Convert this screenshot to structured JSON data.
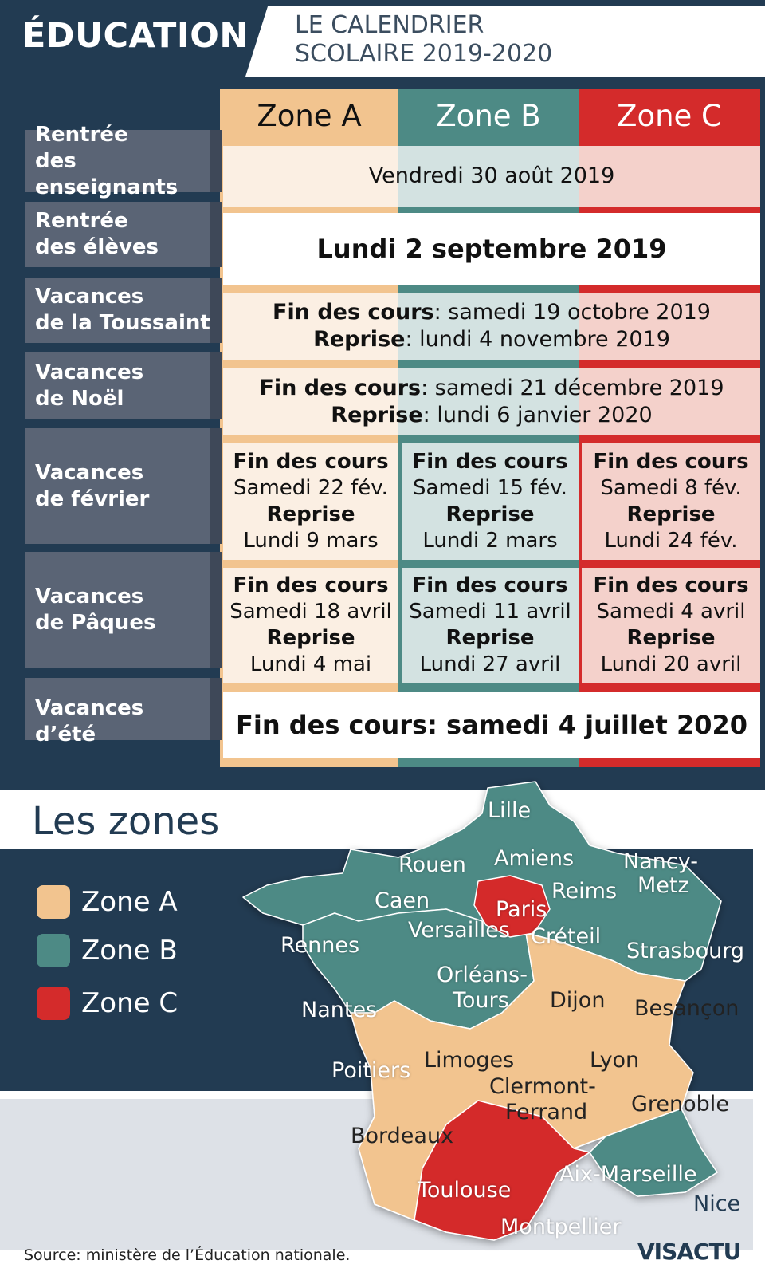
{
  "header": {
    "title": "ÉDUCATION",
    "subtitle_line1": "LE CALENDRIER",
    "subtitle_line2": "SCOLAIRE 2019-2020"
  },
  "zones": {
    "a": {
      "label": "Zone A",
      "color": "#f2c48f"
    },
    "b": {
      "label": "Zone B",
      "color": "#4d8a85"
    },
    "c": {
      "label": "Zone C",
      "color": "#d42b2b"
    }
  },
  "rows": {
    "enseignants": {
      "label1": "Rentrée",
      "label2": "des enseignants",
      "text": "Vendredi 30 août 2019"
    },
    "eleves": {
      "label1": "Rentrée",
      "label2": "des élèves",
      "text": "Lundi 2 septembre 2019"
    },
    "toussaint": {
      "label1": "Vacances",
      "label2": "de la Toussaint",
      "fin_label": "Fin des cours",
      "fin_value": ": samedi 19 octobre 2019",
      "reprise_label": "Reprise",
      "reprise_value": ": lundi 4 novembre 2019"
    },
    "noel": {
      "label1": "Vacances",
      "label2": "de Noël",
      "fin_label": "Fin des cours",
      "fin_value": ": samedi 21 décembre 2019",
      "reprise_label": "Reprise",
      "reprise_value": ": lundi 6 janvier 2020"
    },
    "fevrier": {
      "label1": "Vacances",
      "label2": "de février",
      "a": {
        "fin_label": "Fin des cours",
        "fin": "Samedi 22 fév.",
        "reprise_label": "Reprise",
        "reprise": "Lundi 9 mars"
      },
      "b": {
        "fin_label": "Fin des cours",
        "fin": "Samedi 15 fév.",
        "reprise_label": "Reprise",
        "reprise": "Lundi 2 mars"
      },
      "c": {
        "fin_label": "Fin des cours",
        "fin": "Samedi 8 fév.",
        "reprise_label": "Reprise",
        "reprise": "Lundi 24 fév."
      }
    },
    "paques": {
      "label1": "Vacances",
      "label2": "de Pâques",
      "a": {
        "fin_label": "Fin des cours",
        "fin": "Samedi 18 avril",
        "reprise_label": "Reprise",
        "reprise": "Lundi 4 mai"
      },
      "b": {
        "fin_label": "Fin des cours",
        "fin": "Samedi 11 avril",
        "reprise_label": "Reprise",
        "reprise": "Lundi 27 avril"
      },
      "c": {
        "fin_label": "Fin des cours",
        "fin": "Samedi 4 avril",
        "reprise_label": "Reprise",
        "reprise": "Lundi 20 avril"
      }
    },
    "ete": {
      "label1": "Vacances d’été",
      "text": "Fin des cours: samedi 4 juillet 2020"
    }
  },
  "map": {
    "title": "Les zones",
    "legend": [
      "Zone A",
      "Zone B",
      "Zone C"
    ],
    "cities": {
      "lille": "Lille",
      "rouen": "Rouen",
      "amiens": "Amiens",
      "nancy1": "Nancy-",
      "nancy2": "Metz",
      "caen": "Caen",
      "reims": "Reims",
      "paris": "Paris",
      "versailles": "Versailles",
      "creteil": "Créteil",
      "rennes": "Rennes",
      "strasbourg": "Strasbourg",
      "orleans1": "Orléans-",
      "orleans2": "Tours",
      "nantes": "Nantes",
      "dijon": "Dijon",
      "besancon": "Besançon",
      "poitiers": "Poitiers",
      "limoges": "Limoges",
      "lyon": "Lyon",
      "clermont1": "Clermont-",
      "clermont2": "Ferrand",
      "grenoble": "Grenoble",
      "bordeaux": "Bordeaux",
      "aix": "Aix-Marseille",
      "toulouse": "Toulouse",
      "nice": "Nice",
      "montpellier": "Montpellier"
    }
  },
  "footer": {
    "source": "Source: ministère de l’Éducation nationale.",
    "logo": "VISACTU"
  }
}
